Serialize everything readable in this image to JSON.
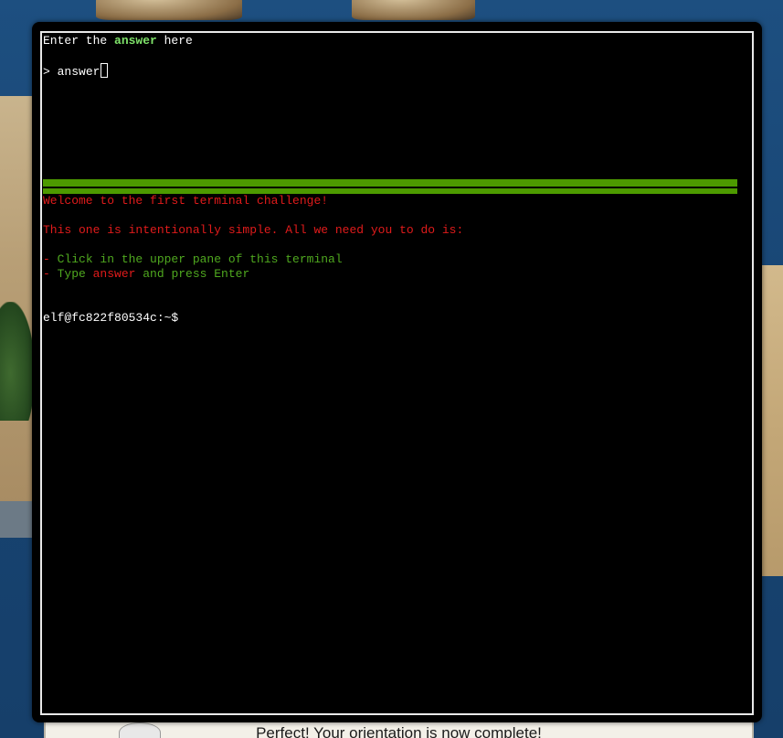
{
  "background": {
    "completion_message": "Perfect! Your orientation is now complete!"
  },
  "terminal": {
    "upper": {
      "instruction_prefix": "Enter the ",
      "instruction_highlight": "answer",
      "instruction_suffix": " here",
      "prompt_symbol": "> ",
      "input_value": "answer"
    },
    "lower": {
      "welcome": "Welcome to the first terminal challenge!",
      "intro": "This one is intentionally simple. All we need you to do is:",
      "step1_dash": "- ",
      "step1_text": "Click in the upper pane of this terminal",
      "step2_dash": "- ",
      "step2_prefix": "Type ",
      "step2_keyword": "answer",
      "step2_suffix": " and press Enter",
      "shell_prompt": "elf@fc822f80534c:~$"
    },
    "colors": {
      "divider": "#4d9a00",
      "red_text": "#e01b1b",
      "green_text": "#4fa81f",
      "highlight": "#7fe36a"
    }
  }
}
